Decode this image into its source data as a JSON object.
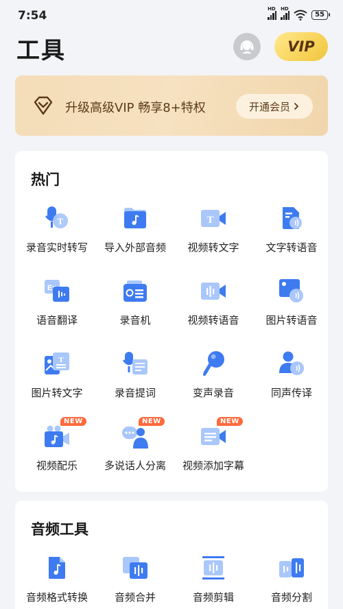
{
  "status_bar": {
    "time": "7:54",
    "battery": "55"
  },
  "header": {
    "title": "工具",
    "vip_label": "VIP"
  },
  "banner": {
    "text": "升级高级VIP 畅享8+特权",
    "button_label": "开通会员"
  },
  "hot": {
    "title": "热门",
    "new_label": "NEW",
    "items": [
      {
        "label": "录音实时转写",
        "icon": "mic-transcribe-icon"
      },
      {
        "label": "导入外部音频",
        "icon": "import-audio-icon"
      },
      {
        "label": "视频转文字",
        "icon": "video-to-text-icon"
      },
      {
        "label": "文字转语音",
        "icon": "text-to-speech-icon"
      },
      {
        "label": "语音翻译",
        "icon": "voice-translate-icon"
      },
      {
        "label": "录音机",
        "icon": "recorder-icon"
      },
      {
        "label": "视频转语音",
        "icon": "video-to-audio-icon"
      },
      {
        "label": "图片转语音",
        "icon": "image-to-speech-icon"
      },
      {
        "label": "图片转文字",
        "icon": "image-to-text-icon"
      },
      {
        "label": "录音提词",
        "icon": "teleprompter-icon"
      },
      {
        "label": "变声录音",
        "icon": "voice-changer-icon"
      },
      {
        "label": "同声传译",
        "icon": "simultaneous-interpret-icon"
      },
      {
        "label": "视频配乐",
        "icon": "video-music-icon",
        "new": true
      },
      {
        "label": "多说话人分离",
        "icon": "speaker-separation-icon",
        "new": true
      },
      {
        "label": "视频添加字幕",
        "icon": "video-subtitle-icon",
        "new": true
      }
    ]
  },
  "audio_tools": {
    "title": "音频工具",
    "items": [
      {
        "label": "音频格式转换",
        "icon": "audio-convert-icon"
      },
      {
        "label": "音频合并",
        "icon": "audio-merge-icon"
      },
      {
        "label": "音频剪辑",
        "icon": "audio-cut-icon"
      },
      {
        "label": "音频分割",
        "icon": "audio-split-icon"
      }
    ]
  },
  "colors": {
    "primary": "#3e7bf0",
    "light": "#a9c7fb",
    "banner_bg": "#f4ddb8",
    "vip_gold": "#f7d35a",
    "new_badge": "#ff6a3d"
  }
}
